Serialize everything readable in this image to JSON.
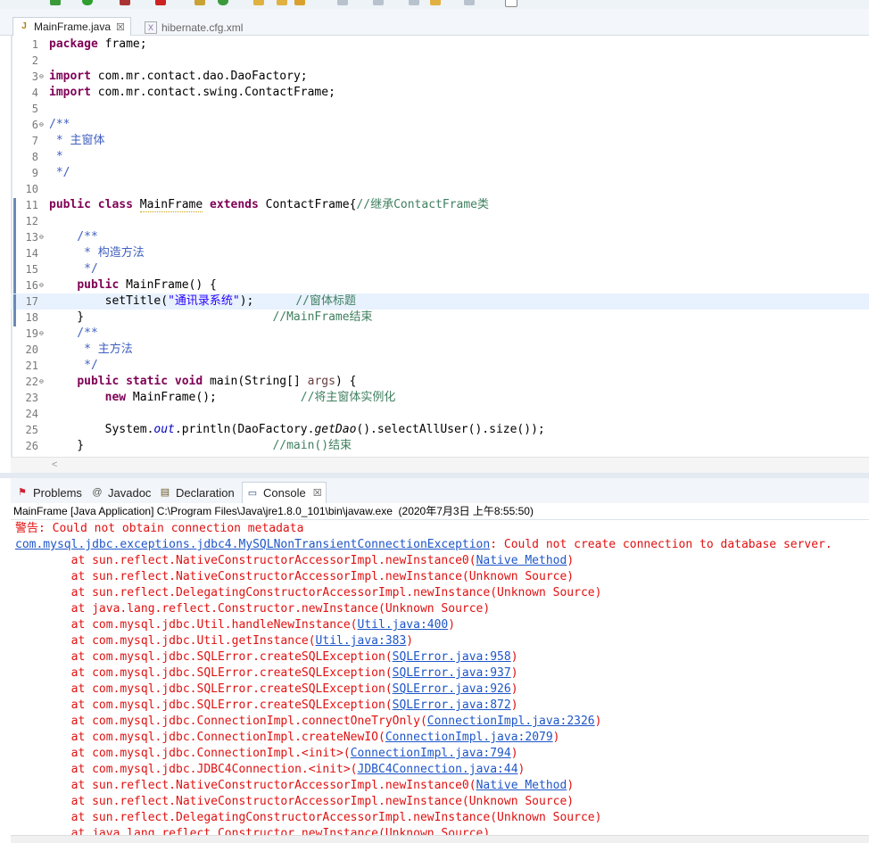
{
  "editor_tabs": [
    {
      "label": "MainFrame.java",
      "icon": "java-file-icon",
      "active": true,
      "close": "☒"
    },
    {
      "label": "hibernate.cfg.xml",
      "icon": "xml-file-icon",
      "active": false
    }
  ],
  "code_lines": [
    {
      "n": "1",
      "fold": "",
      "mark": false
    },
    {
      "n": "2",
      "fold": "",
      "mark": false
    },
    {
      "n": "3",
      "fold": "⊖",
      "mark": false
    },
    {
      "n": "4",
      "fold": "",
      "mark": false
    },
    {
      "n": "5",
      "fold": "",
      "mark": false
    },
    {
      "n": "6",
      "fold": "⊖",
      "mark": false
    },
    {
      "n": "7",
      "fold": "",
      "mark": false
    },
    {
      "n": "8",
      "fold": "",
      "mark": false
    },
    {
      "n": "9",
      "fold": "",
      "mark": false
    },
    {
      "n": "10",
      "fold": "",
      "mark": false
    },
    {
      "n": "11",
      "fold": "",
      "mark": true
    },
    {
      "n": "12",
      "fold": "",
      "mark": true
    },
    {
      "n": "13",
      "fold": "⊖",
      "mark": true
    },
    {
      "n": "14",
      "fold": "",
      "mark": true
    },
    {
      "n": "15",
      "fold": "",
      "mark": true
    },
    {
      "n": "16",
      "fold": "⊖",
      "mark": true
    },
    {
      "n": "17",
      "fold": "",
      "mark": true
    },
    {
      "n": "18",
      "fold": "",
      "mark": true
    },
    {
      "n": "19",
      "fold": "⊖",
      "mark": false
    },
    {
      "n": "20",
      "fold": "",
      "mark": false
    },
    {
      "n": "21",
      "fold": "",
      "mark": false
    },
    {
      "n": "22",
      "fold": "⊖",
      "mark": false
    },
    {
      "n": "23",
      "fold": "",
      "mark": false
    },
    {
      "n": "24",
      "fold": "",
      "mark": false
    },
    {
      "n": "25",
      "fold": "",
      "mark": false
    },
    {
      "n": "26",
      "fold": "",
      "mark": false
    }
  ],
  "code": {
    "l1": {
      "kw": "package",
      "rest": " frame;"
    },
    "l3": {
      "kw": "import",
      "rest": " com.mr.contact.dao.DaoFactory;"
    },
    "l4": {
      "kw": "import",
      "rest": " com.mr.contact.swing.ContactFrame;"
    },
    "l6": "/**",
    "l7": " * 主窗体",
    "l8": " *",
    "l9": " */",
    "l11": {
      "kw1": "public",
      "kw2": "class",
      "name": "MainFrame",
      "kw3": "extends",
      "rest": " ContactFrame{",
      "comment": "//继承ContactFrame类"
    },
    "l13": "    /**",
    "l14": "     * 构造方法",
    "l15": "     */",
    "l16": {
      "indent": "    ",
      "kw": "public",
      "rest": " MainFrame() {"
    },
    "l17": {
      "pre": "        setTitle(",
      "str": "\"通讯录系统\"",
      "post": ");      ",
      "comment": "//窗体标题"
    },
    "l18": {
      "pre": "    }                           ",
      "comment": "//MainFrame结束"
    },
    "l19": "    /**",
    "l20": "     * 主方法",
    "l21": "     */",
    "l22": {
      "indent": "    ",
      "kw1": "public",
      "kw2": "static",
      "kw3": "void",
      "pre": " main(String[] ",
      "arg": "args",
      "post": ") {"
    },
    "l23": {
      "indent": "        ",
      "kw": "new",
      "rest": " MainFrame();            ",
      "comment": "//将主窗体实例化"
    },
    "l25": {
      "pre": "        System.",
      "field": "out",
      "mid": ".println(DaoFactory.",
      "method": "getDao",
      "post": "().selectAllUser().size());"
    },
    "l26": {
      "pre": "    }                           ",
      "comment": "//main()结束"
    }
  },
  "console_tabs": [
    {
      "label": "Problems",
      "icon": "problems-icon",
      "glyph": "⚑"
    },
    {
      "label": "Javadoc",
      "icon": "javadoc-icon",
      "glyph": "@"
    },
    {
      "label": "Declaration",
      "icon": "declaration-icon",
      "glyph": "▤"
    },
    {
      "label": "Console",
      "icon": "console-icon",
      "glyph": "▭",
      "close": "☒"
    }
  ],
  "console_header": "MainFrame [Java Application] C:\\Program Files\\Java\\jre1.8.0_101\\bin\\javaw.exe  (2020年7月3日 上午8:55:50)",
  "console_lines": [
    {
      "pre": "警告: Could not obtain connection metadata",
      "link": "",
      "post": ""
    },
    {
      "pre": "",
      "link": "com.mysql.jdbc.exceptions.jdbc4.MySQLNonTransientConnectionException",
      "post": ": Could not create connection to database server."
    },
    {
      "pre": "        at sun.reflect.NativeConstructorAccessorImpl.newInstance0(",
      "link": "Native Method",
      "post": ")"
    },
    {
      "pre": "        at sun.reflect.NativeConstructorAccessorImpl.newInstance(Unknown Source)",
      "link": "",
      "post": ""
    },
    {
      "pre": "        at sun.reflect.DelegatingConstructorAccessorImpl.newInstance(Unknown Source)",
      "link": "",
      "post": ""
    },
    {
      "pre": "        at java.lang.reflect.Constructor.newInstance(Unknown Source)",
      "link": "",
      "post": ""
    },
    {
      "pre": "        at com.mysql.jdbc.Util.handleNewInstance(",
      "link": "Util.java:400",
      "post": ")"
    },
    {
      "pre": "        at com.mysql.jdbc.Util.getInstance(",
      "link": "Util.java:383",
      "post": ")"
    },
    {
      "pre": "        at com.mysql.jdbc.SQLError.createSQLException(",
      "link": "SQLError.java:958",
      "post": ")"
    },
    {
      "pre": "        at com.mysql.jdbc.SQLError.createSQLException(",
      "link": "SQLError.java:937",
      "post": ")"
    },
    {
      "pre": "        at com.mysql.jdbc.SQLError.createSQLException(",
      "link": "SQLError.java:926",
      "post": ")"
    },
    {
      "pre": "        at com.mysql.jdbc.SQLError.createSQLException(",
      "link": "SQLError.java:872",
      "post": ")"
    },
    {
      "pre": "        at com.mysql.jdbc.ConnectionImpl.connectOneTryOnly(",
      "link": "ConnectionImpl.java:2326",
      "post": ")"
    },
    {
      "pre": "        at com.mysql.jdbc.ConnectionImpl.createNewIO(",
      "link": "ConnectionImpl.java:2079",
      "post": ")"
    },
    {
      "pre": "        at com.mysql.jdbc.ConnectionImpl.<init>(",
      "link": "ConnectionImpl.java:794",
      "post": ")"
    },
    {
      "pre": "        at com.mysql.jdbc.JDBC4Connection.<init>(",
      "link": "JDBC4Connection.java:44",
      "post": ")"
    },
    {
      "pre": "        at sun.reflect.NativeConstructorAccessorImpl.newInstance0(",
      "link": "Native Method",
      "post": ")"
    },
    {
      "pre": "        at sun.reflect.NativeConstructorAccessorImpl.newInstance(Unknown Source)",
      "link": "",
      "post": ""
    },
    {
      "pre": "        at sun.reflect.DelegatingConstructorAccessorImpl.newInstance(Unknown Source)",
      "link": "",
      "post": ""
    },
    {
      "pre": "        at java.lang.reflect.Constructor.newInstance(Unknown Source)",
      "link": "",
      "post": ""
    }
  ],
  "colors": {
    "keyword": "#7f0055",
    "comment": "#3f7f5f",
    "javadoc": "#3f5fbf",
    "string": "#2a00ff",
    "error": "#e01010",
    "link": "#1e56c8",
    "current_line": "#e8f2fe"
  }
}
